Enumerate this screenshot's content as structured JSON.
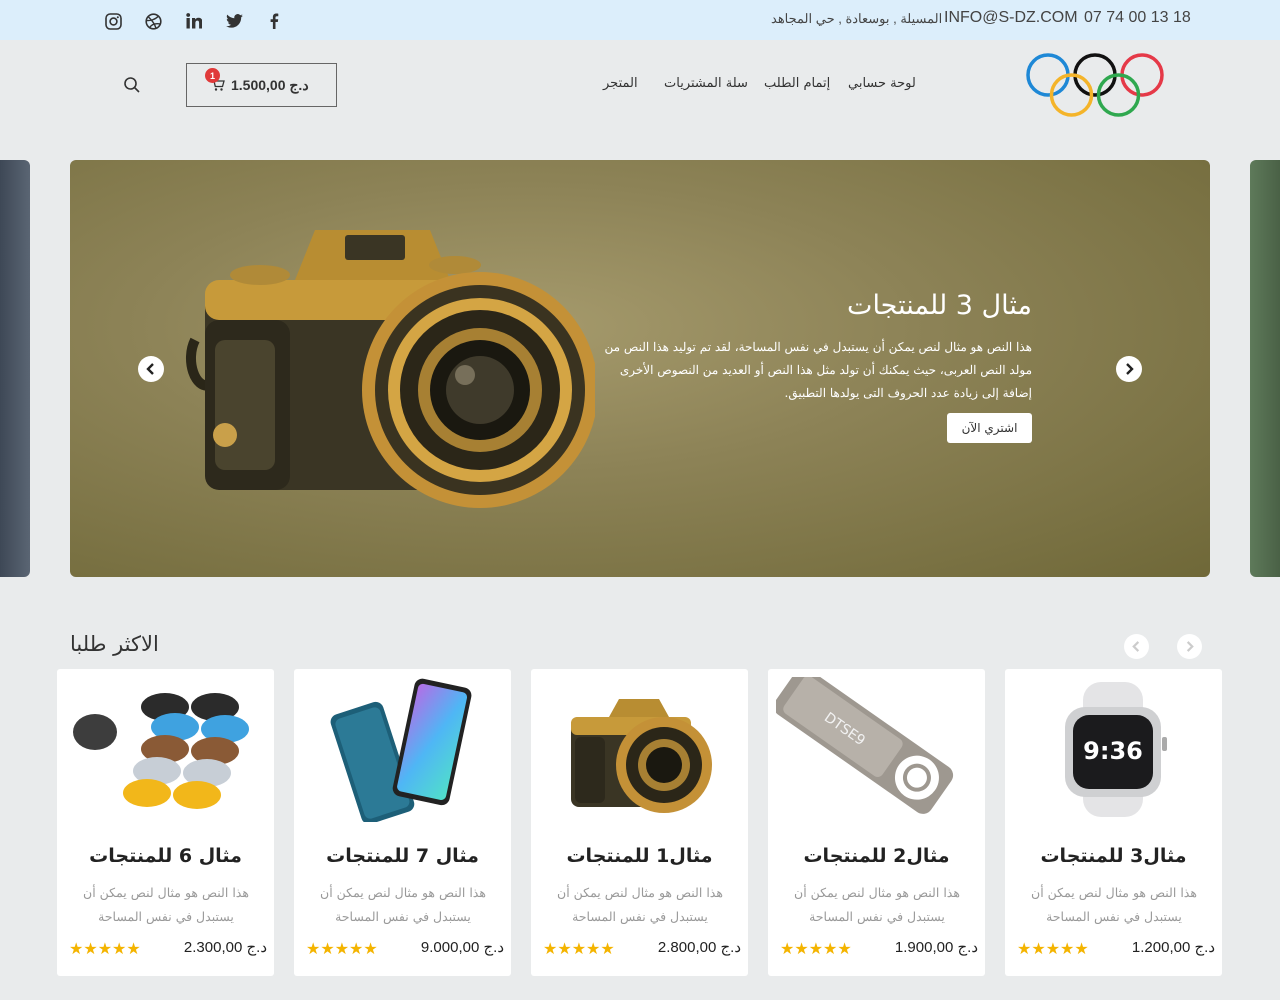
{
  "topbar": {
    "phone": "07 74 00 13 18",
    "email": "INFO@S-DZ.COM",
    "address": "المسيلة , بوسعادة , حي المجاهد",
    "social_icons": [
      "facebook-icon",
      "twitter-icon",
      "linkedin-icon",
      "dribbble-icon",
      "instagram-icon"
    ]
  },
  "header": {
    "logo": "olympic-rings-logo",
    "nav": [
      "لوحة حسابي",
      "إتمام الطلب",
      "سلة المشتريات",
      "المتجر"
    ],
    "cart": {
      "count": "1",
      "total": "1.500,00 د.ج"
    }
  },
  "slider": {
    "title": "مثال 3 للمنتجات",
    "text": "هذا النص هو مثال لنص يمكن أن يستبدل في نفس المساحة، لقد تم توليد هذا النص من مولد النص العربى، حيث يمكنك أن تولد مثل هذا النص أو العديد من النصوص الأخرى إضافة إلى زيادة عدد الحروف التى يولدها التطبيق.",
    "button": "اشتري الآن"
  },
  "products": {
    "section_title": "الاكثر طلبا",
    "items": [
      {
        "title": "مثال3 للمنتجات",
        "desc": "هذا النص هو مثال لنص يمكن أن يستبدل في نفس المساحة",
        "price": "1.200,00 د.ج",
        "rating": 5,
        "image": "smartwatch"
      },
      {
        "title": "مثال2 للمنتجات",
        "desc": "هذا النص هو مثال لنص يمكن أن يستبدل في نفس المساحة",
        "price": "1.900,00 د.ج",
        "rating": 5,
        "image": "usb-drive"
      },
      {
        "title": "مثال1 للمنتجات",
        "desc": "هذا النص هو مثال لنص يمكن أن يستبدل في نفس المساحة",
        "price": "2.800,00 د.ج",
        "rating": 5,
        "image": "camera"
      },
      {
        "title": "مثال 7 للمنتجات",
        "desc": "هذا النص هو مثال لنص يمكن أن يستبدل في نفس المساحة",
        "price": "9.000,00 د.ج",
        "rating": 5,
        "image": "smartphone"
      },
      {
        "title": "مثال 6 للمنتجات",
        "desc": "هذا النص هو مثال لنص يمكن أن يستبدل في نفس المساحة",
        "price": "2.300,00 د.ج",
        "rating": 5,
        "image": "sunglasses"
      }
    ]
  },
  "colors": {
    "topbar_bg": "#dceefb",
    "page_bg": "#e9ebec",
    "star": "#f4b400",
    "badge": "#e03a3a"
  }
}
